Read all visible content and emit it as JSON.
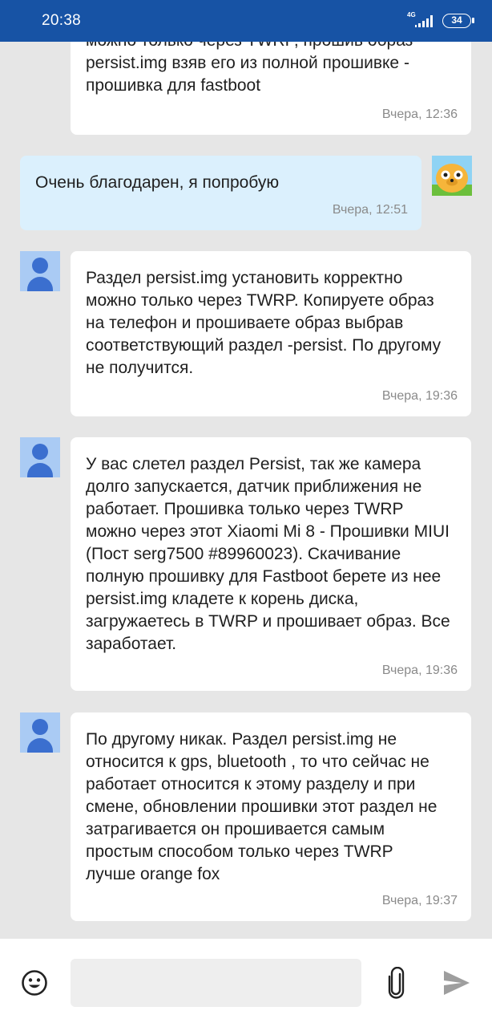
{
  "status_bar": {
    "time": "20:38",
    "network": "4G",
    "battery": "34"
  },
  "messages": [
    {
      "sender": "other",
      "text": "можно только через TWRP, прошив образ persist.img взяв его из полной прошивке - прошивка для fastboot",
      "time": "Вчера, 12:36"
    },
    {
      "sender": "me",
      "text": "Очень благодарен, я попробую",
      "time": "Вчера, 12:51"
    },
    {
      "sender": "other",
      "text": "Раздел persist.img установить корректно можно только через TWRP. Копируете образ на телефон и прошиваете образ выбрав соответствующий раздел -persist. По другому не получится.",
      "time": "Вчера, 19:36"
    },
    {
      "sender": "other",
      "text": "У вас слетел раздел Persist, так же камера долго запускается, датчик приближения не работает. Прошивка только через TWRP можно через этот Xiaomi Mi 8 - Прошивки MIUI (Пост serg7500 #89960023). Скачивание полную прошивку для Fastboot берете из нее persist.img кладете к корень диска, загружаетесь в TWRP и прошивает образ. Все заработает.",
      "time": "Вчера, 19:36"
    },
    {
      "sender": "other",
      "text": "По другому никак. Раздел persist.img не относится к gps, bluetooth , то что сейчас не работает относится к этому разделу и при смене, обновлении прошивки этот раздел не затрагивается он прошивается самым простым способом только через TWRP лучше orange fox",
      "time": "Вчера, 19:37"
    }
  ],
  "composer": {
    "placeholder": ""
  },
  "icons": {
    "emoji": "emoji-smile-icon",
    "attach": "paperclip-icon",
    "send": "send-arrow-icon"
  },
  "colors": {
    "status_bar": "#1753a5",
    "my_bubble": "#dbf0fd",
    "other_bubble": "#ffffff",
    "background": "#e6e6e6"
  }
}
